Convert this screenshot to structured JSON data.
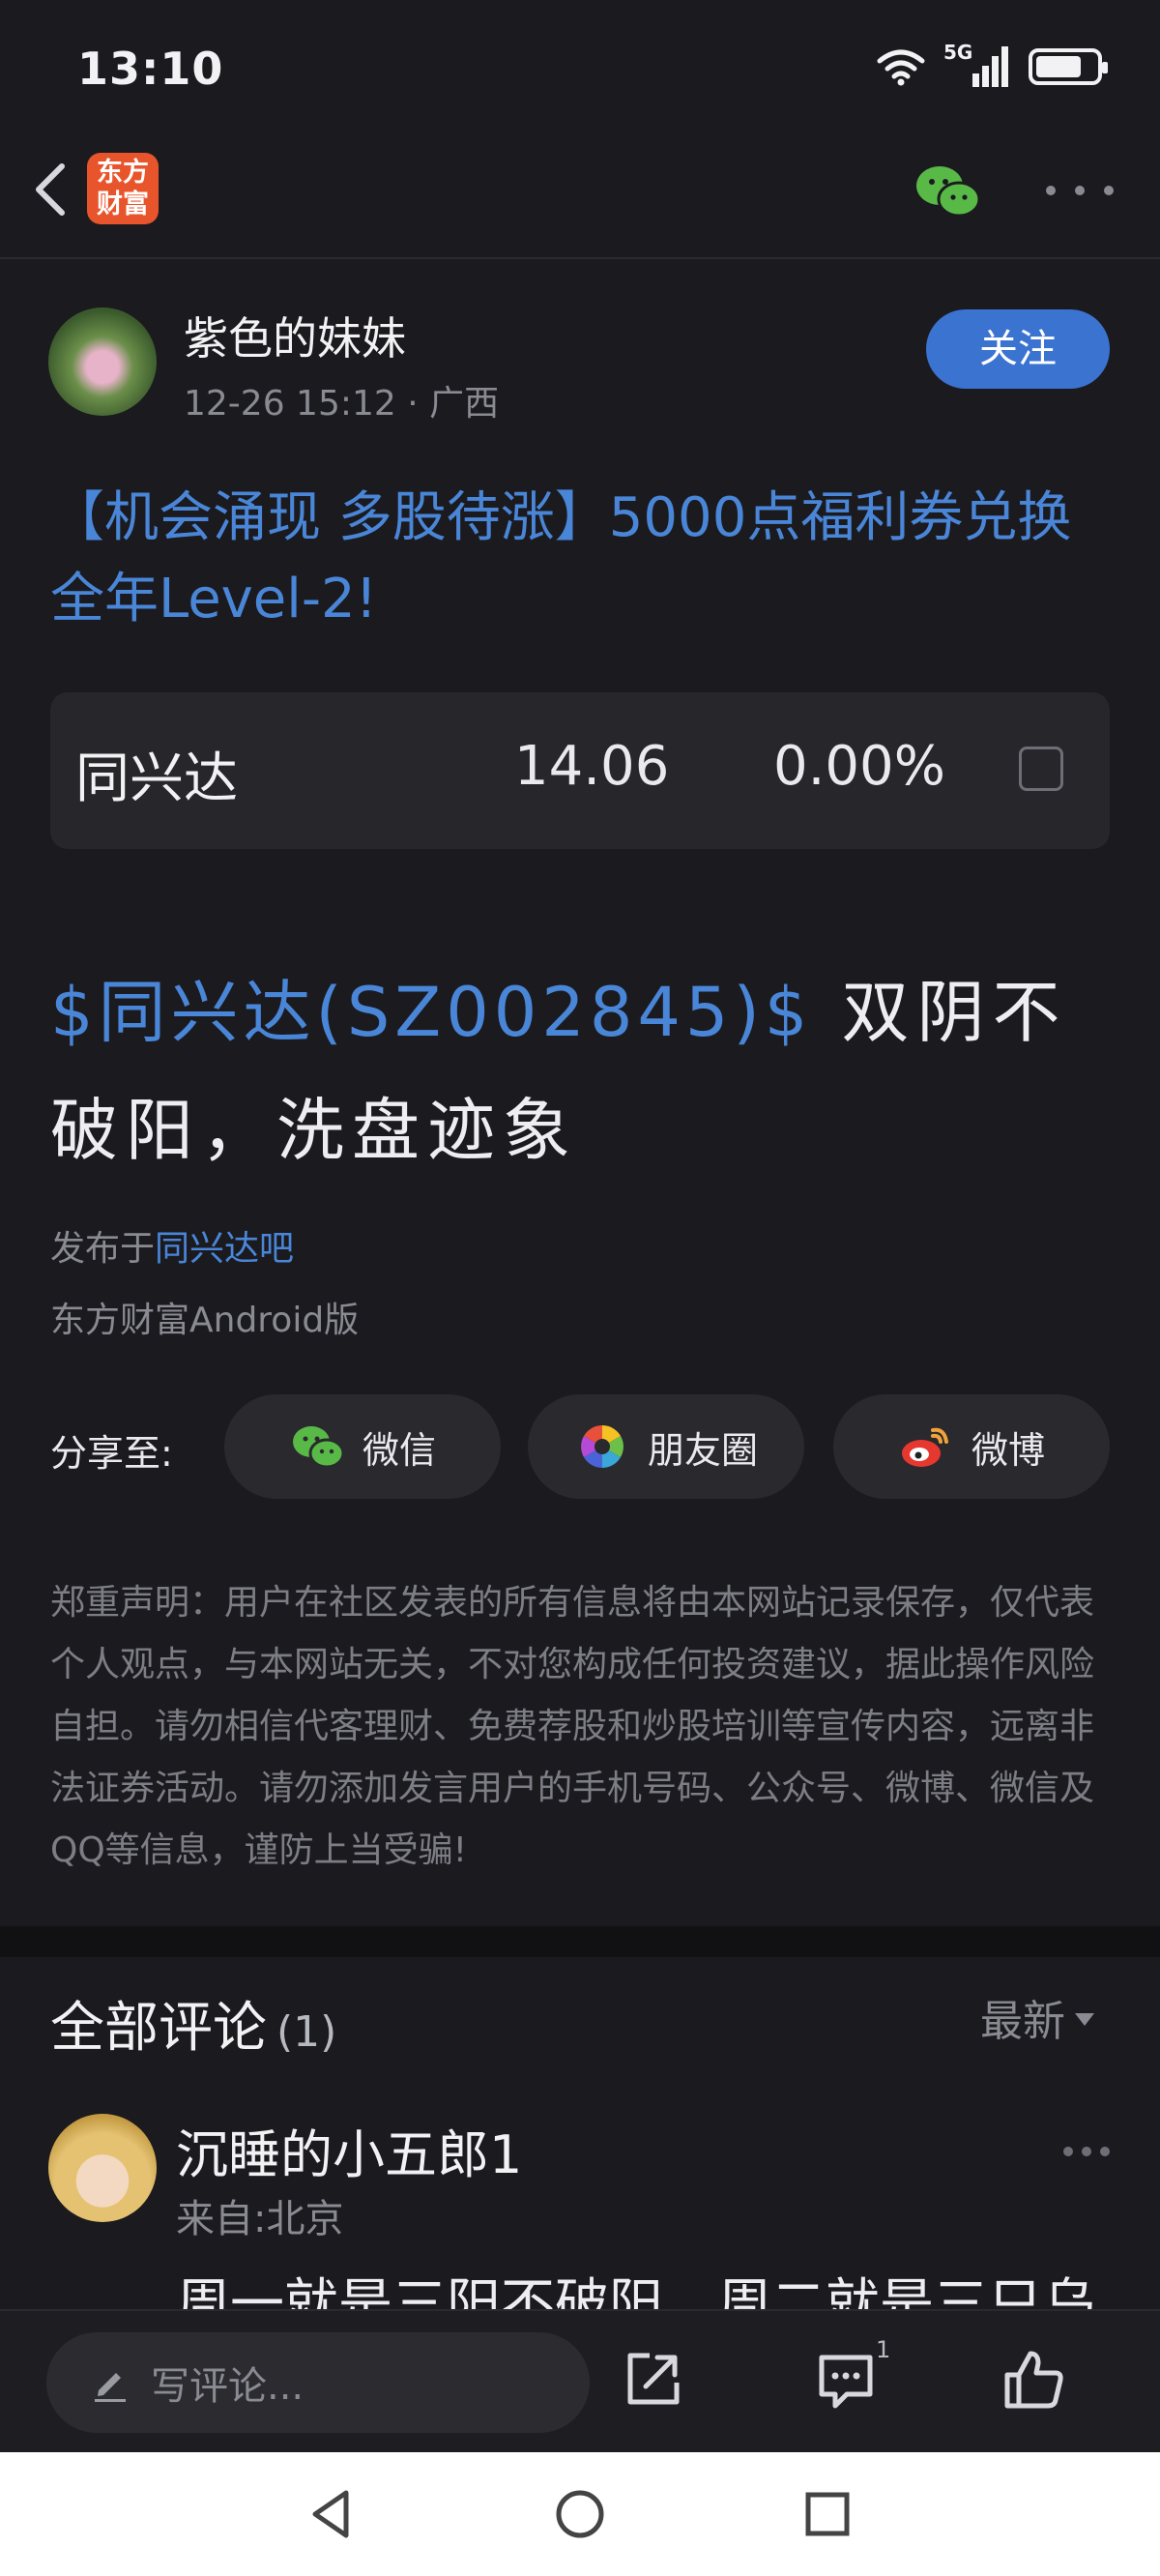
{
  "status_bar": {
    "time": "13:10",
    "network": "5G"
  },
  "nav": {
    "app_logo_text": "东方财富"
  },
  "post": {
    "author": "紫色的妹妹",
    "meta": "12-26 15:12 · 广西",
    "follow_label": "关注",
    "title": "【机会涌现 多股待涨】5000点福利券兑换全年Level-2!",
    "stock_card": {
      "name": "同兴达",
      "price": "14.06",
      "change": "0.00%"
    },
    "body_stock_link": "$同兴达(SZ002845)$",
    "body_text": " 双阴不破阳，洗盘迹象",
    "published_prefix": "发布于",
    "published_bar": "同兴达吧",
    "client": "东方财富Android版"
  },
  "share": {
    "label": "分享至:",
    "wechat": "微信",
    "moments": "朋友圈",
    "weibo": "微博"
  },
  "disclaimer": "郑重声明：用户在社区发表的所有信息将由本网站记录保存，仅代表个人观点，与本网站无关，不对您构成任何投资建议，据此操作风险自担。请勿相信代客理财、免费荐股和炒股培训等宣传内容，远离非法证券活动。请勿添加发言用户的手机号码、公众号、微博、微信及QQ等信息，谨防上当受骗!",
  "comments": {
    "title": "全部评论",
    "count": "(1)",
    "sort_label": "最新",
    "items": [
      {
        "name": "沉睡的小五郎1",
        "location": "来自:北京",
        "text": "周一就是三阳不破阳，周二就是三只乌"
      }
    ]
  },
  "action_bar": {
    "comment_placeholder": "写评论...",
    "comment_badge": "1"
  },
  "colors": {
    "background": "#1b1b1f",
    "accent_blue": "#4a86d8",
    "follow_button": "#3b73d1",
    "logo_orange": "#e8552c"
  }
}
